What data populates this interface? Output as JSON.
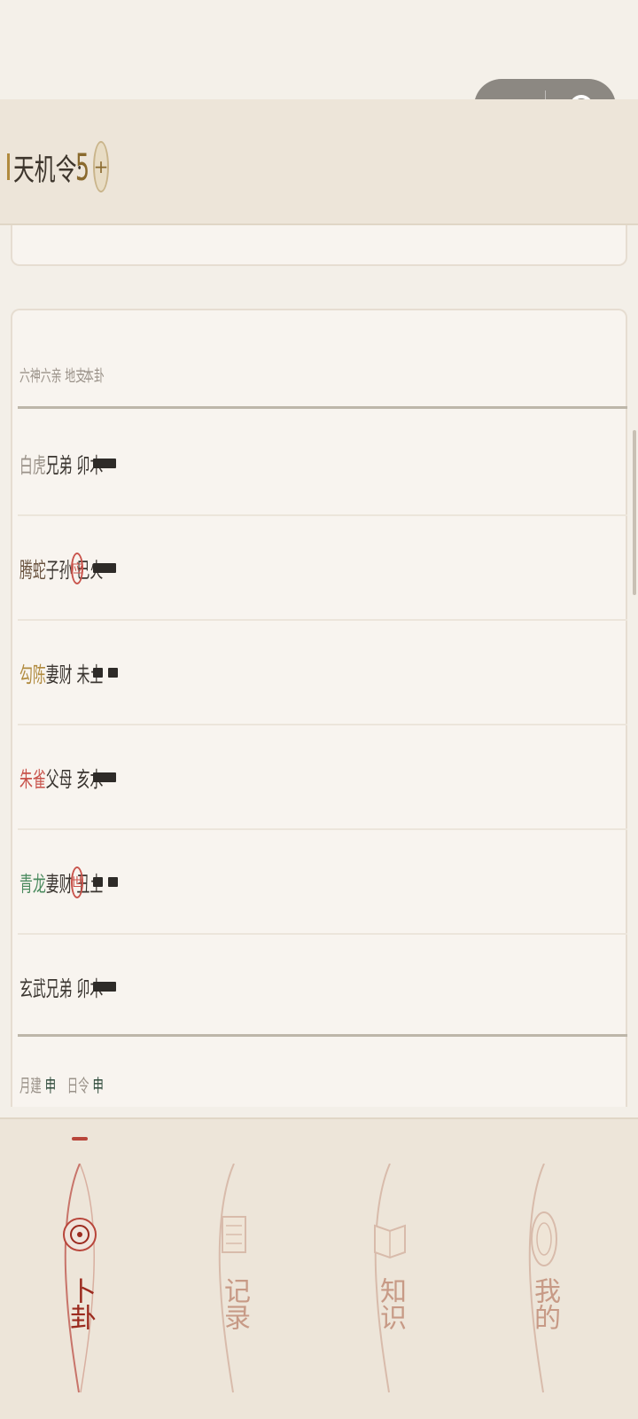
{
  "capsule": {
    "more_icon": "more-dots-icon",
    "close_icon": "target-circle-icon"
  },
  "header": {
    "tianji_label": "天机令:",
    "tianji_count": "5",
    "plus_label": "+"
  },
  "table": {
    "headers": {
      "left": "六神六亲 地支",
      "right": "本卦"
    },
    "rows": [
      {
        "spirit": "白虎",
        "relative": "兄弟",
        "branch": "卯木",
        "badge": "",
        "yao": "yang",
        "spirit_color": "#9a9289"
      },
      {
        "spirit": "腾蛇",
        "relative": "子孙",
        "branch": "巳火",
        "badge": "应",
        "yao": "yang",
        "spirit_color": "#6b5440"
      },
      {
        "spirit": "勾陈",
        "relative": "妻财",
        "branch": "未土",
        "badge": "",
        "yao": "yin",
        "spirit_color": "#b08a3e"
      },
      {
        "spirit": "朱雀",
        "relative": "父母",
        "branch": "亥水",
        "badge": "",
        "yao": "yang",
        "spirit_color": "#c8524a"
      },
      {
        "spirit": "青龙",
        "relative": "妻财",
        "branch": "丑土",
        "badge": "世",
        "yao": "yin",
        "spirit_color": "#4a8a5e"
      },
      {
        "spirit": "玄武",
        "relative": "兄弟",
        "branch": "卯木",
        "badge": "",
        "yao": "yang",
        "spirit_color": "#3a3530"
      }
    ],
    "footer": {
      "month_label": "月建",
      "month_value": "申",
      "day_label": "日令",
      "day_value": "申"
    }
  },
  "tabs": [
    {
      "label": "卜卦",
      "icon": "divination-bagua-icon",
      "active": true
    },
    {
      "label": "记录",
      "icon": "scroll-record-icon",
      "active": false
    },
    {
      "label": "知识",
      "icon": "open-book-icon",
      "active": false
    },
    {
      "label": "我的",
      "icon": "profile-seal-icon",
      "active": false
    }
  ],
  "colors": {
    "background": "#f3efe8",
    "header": "#ede5d9",
    "card": "#f8f4ef",
    "accent_red": "#b8453a",
    "gold": "#8a6a2e"
  }
}
